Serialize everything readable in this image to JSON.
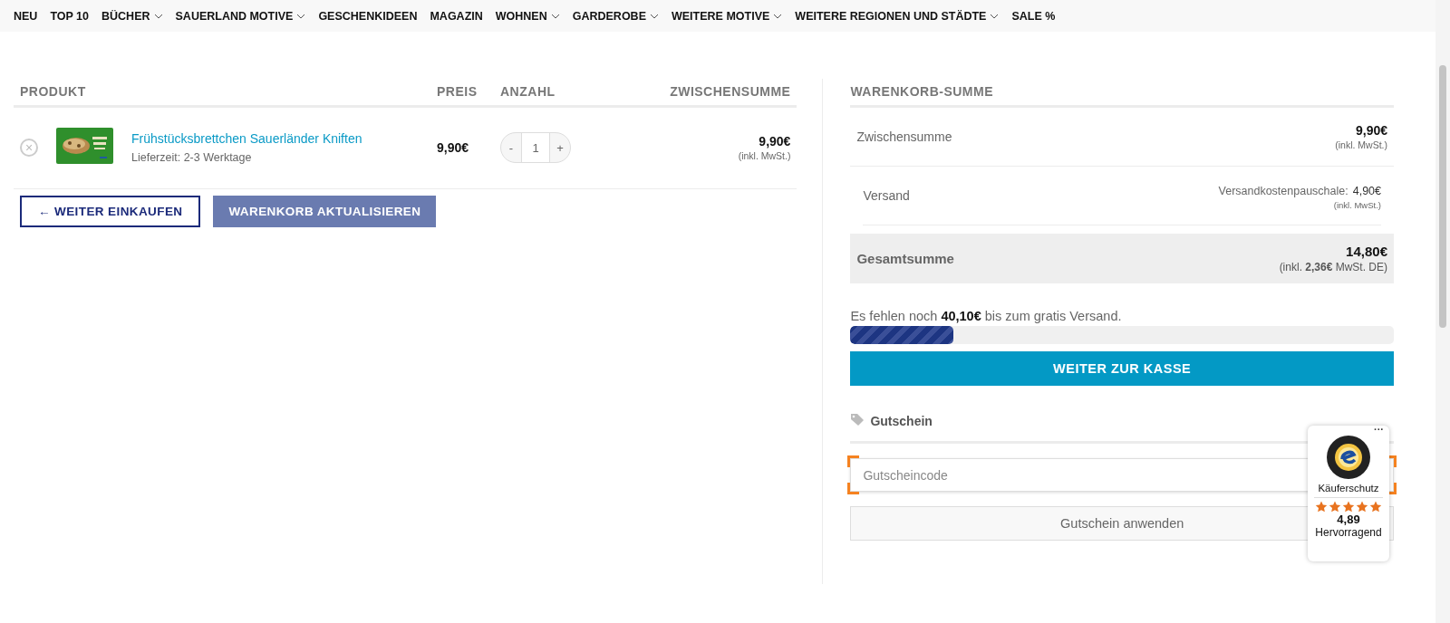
{
  "nav": {
    "items": [
      {
        "label": "NEU",
        "has_dropdown": false
      },
      {
        "label": "TOP 10",
        "has_dropdown": false
      },
      {
        "label": "BÜCHER",
        "has_dropdown": true
      },
      {
        "label": "SAUERLAND MOTIVE",
        "has_dropdown": true
      },
      {
        "label": "GESCHENKIDEEN",
        "has_dropdown": false
      },
      {
        "label": "MAGAZIN",
        "has_dropdown": false
      },
      {
        "label": "WOHNEN",
        "has_dropdown": true
      },
      {
        "label": "GARDEROBE",
        "has_dropdown": true
      },
      {
        "label": "WEITERE MOTIVE",
        "has_dropdown": true
      },
      {
        "label": "WEITERE REGIONEN UND STÄDTE",
        "has_dropdown": true
      },
      {
        "label": "SALE %",
        "has_dropdown": false
      }
    ]
  },
  "cart": {
    "columns": [
      "PRODUKT",
      "PREIS",
      "ANZAHL",
      "ZWISCHENSUMME"
    ],
    "rows": [
      {
        "name": "Frühstücksbrettchen Sauerländer Kniften",
        "delivery": "Lieferzeit: 2-3 Werktage",
        "price": "9,90€",
        "minus": "-",
        "quantity": "1",
        "plus": "+",
        "subtotal": "9,90€",
        "tax_note": "(inkl. MwSt.)",
        "remove": "×"
      }
    ],
    "buttons": [
      {
        "label": "← WEITER EINKAUFEN",
        "kind": "outline"
      },
      {
        "label": "WARENKORB AKTUALISIEREN",
        "kind": "filled"
      }
    ]
  },
  "totals": {
    "title": "WARENKORB-SUMME",
    "subtotal": {
      "label": "Zwischensumme",
      "value": "9,90€",
      "note": "(inkl. MwSt.)"
    },
    "shipping": {
      "label": "Versand",
      "method": "Versandkostenpauschale:",
      "value": "4,90€",
      "note": "(inkl. MwSt.)"
    },
    "total": {
      "label": "Gesamtsumme",
      "value": "14,80€",
      "note": "(inkl. **2,36€** MwSt. DE)"
    },
    "free_shipping": {
      "text": "Es fehlen noch **40,10€** bis zum gratis Versand.",
      "level": 0.19
    },
    "checkout_button": "WEITER ZUR KASSE",
    "coupon": {
      "title": "Gutschein",
      "placeholder": "Gutscheincode",
      "button": "Gutschein anwenden"
    }
  },
  "trust_badge": {
    "menu": "···",
    "label": "Käuferschutz",
    "stars": 5,
    "rating": "4,89",
    "verdict": "Hervorragend"
  }
}
